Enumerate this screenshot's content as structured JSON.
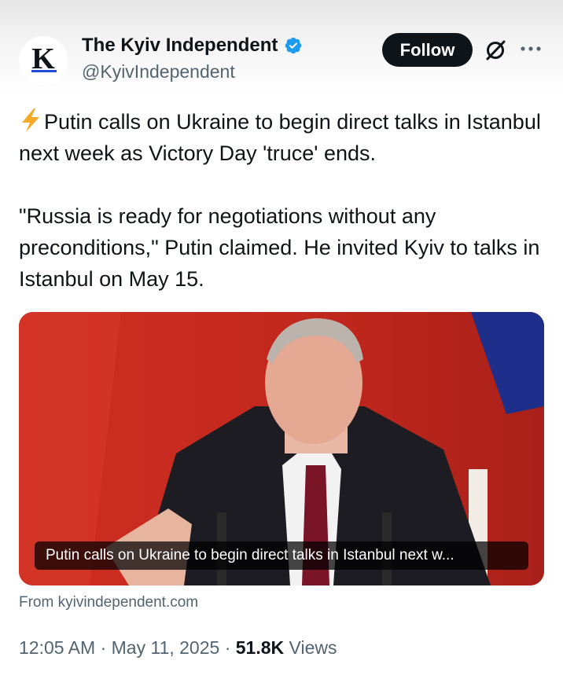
{
  "account": {
    "avatar_letter": "K",
    "name": "The Kyiv Independent",
    "handle": "@KyivIndependent",
    "verified": true
  },
  "actions": {
    "follow_label": "Follow",
    "grok_icon": "grok-icon",
    "more_icon": "more-icon"
  },
  "tweet": {
    "line1": "Putin calls on Ukraine to begin direct talks in Istanbul next week as Victory Day 'truce' ends.",
    "line2": "\"Russia is ready for negotiations without any preconditions,\" Putin claimed. He invited Kyiv to talks in Istanbul on May 15."
  },
  "card": {
    "caption": "Putin calls on Ukraine to begin direct talks in Istanbul next w...",
    "source": "From kyivindependent.com"
  },
  "meta": {
    "time": "12:05 AM",
    "date": "May 11, 2025",
    "views_count": "51.8K",
    "views_label": "Views"
  },
  "colors": {
    "accent": "#1d9bf0",
    "text": "#0f1419",
    "muted": "#536471",
    "flag_red": "#c8281e"
  }
}
